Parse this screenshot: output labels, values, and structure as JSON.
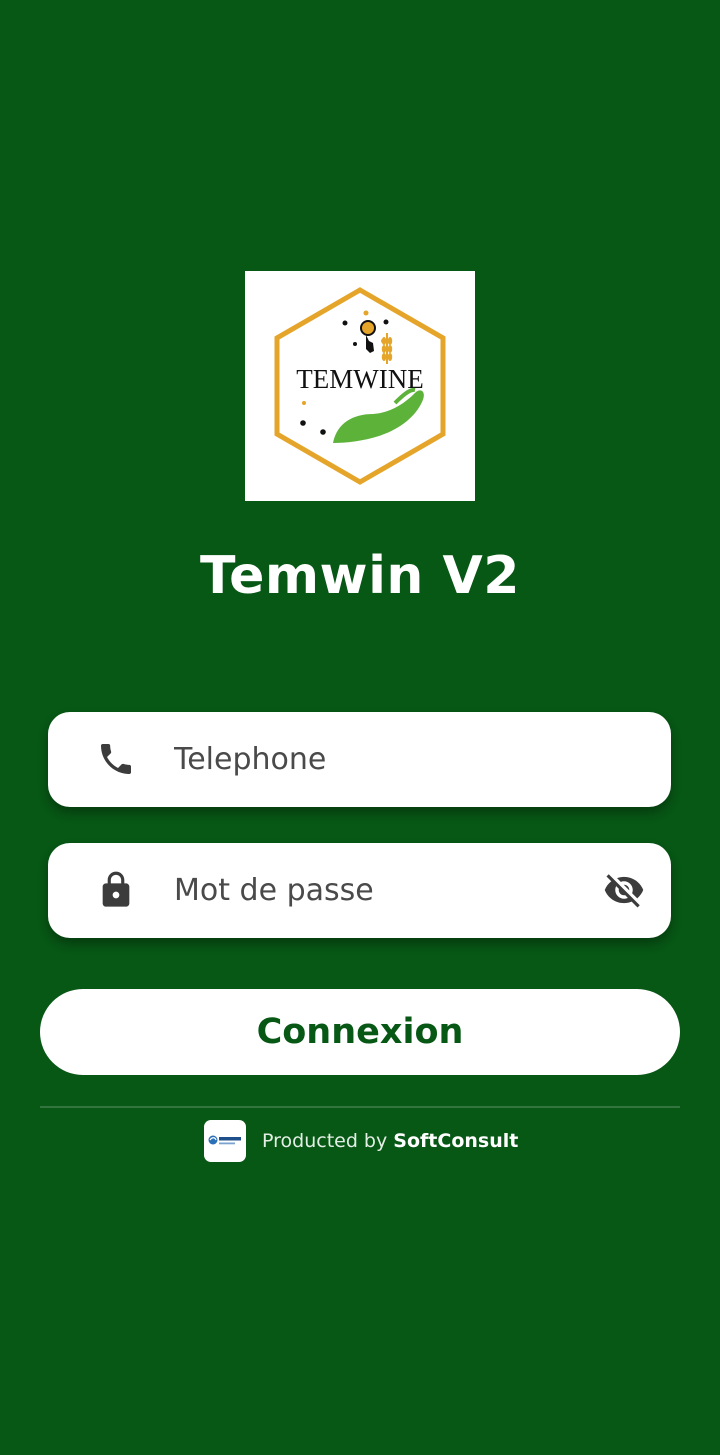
{
  "app": {
    "title": "Temwin V2",
    "logo_text": "TEMWINE"
  },
  "form": {
    "phone": {
      "placeholder": "Telephone",
      "value": "",
      "icon": "phone-icon"
    },
    "password": {
      "placeholder": "Mot de passe",
      "value": "",
      "icon": "lock-icon",
      "toggle_icon": "eye-off-icon"
    },
    "submit_label": "Connexion"
  },
  "footer": {
    "prefix": "Producted by",
    "brand": "SoftConsult"
  },
  "colors": {
    "background": "#075715",
    "logo_gold": "#E5A52A",
    "logo_green": "#5DB33A",
    "button_text": "#075715"
  }
}
